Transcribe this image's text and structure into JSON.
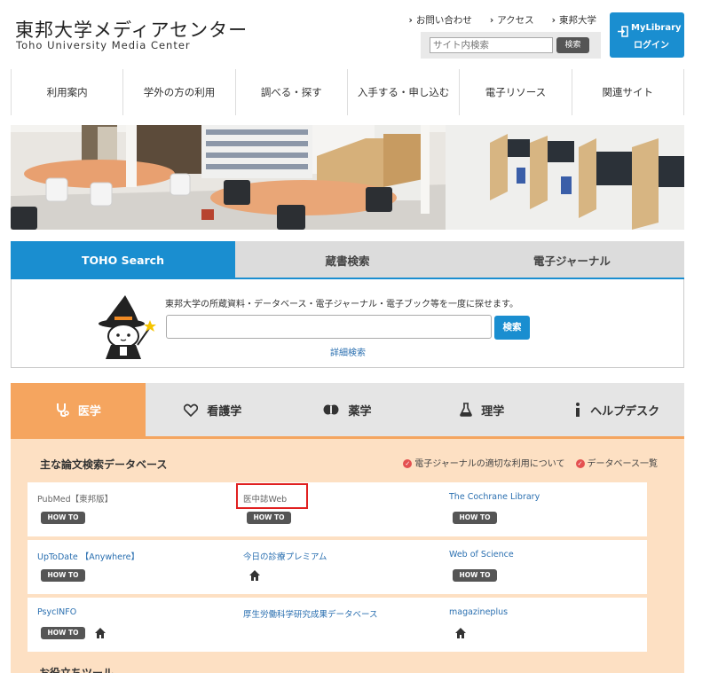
{
  "header": {
    "logo_jp": "東邦大学メディアセンター",
    "logo_en": "Toho University Media Center",
    "top_links": [
      "お問い合わせ",
      "アクセス",
      "東邦大学"
    ],
    "site_search_placeholder": "サイト内検索",
    "site_search_button": "検索",
    "mylibrary_line1": "MyLibrary",
    "mylibrary_line2": "ログイン"
  },
  "nav": [
    "利用案内",
    "学外の方の利用",
    "調べる・探す",
    "入手する・申し込む",
    "電子リソース",
    "関連サイト"
  ],
  "search": {
    "tabs": [
      "TOHO Search",
      "蔵書検索",
      "電子ジャーナル"
    ],
    "description": "東邦大学の所蔵資料・データベース・電子ジャーナル・電子ブック等を一度に探せます。",
    "button": "検索",
    "advanced": "詳細検索"
  },
  "subjects": [
    {
      "label": "医学",
      "icon": "stethoscope-icon"
    },
    {
      "label": "看護学",
      "icon": "heart-icon"
    },
    {
      "label": "薬学",
      "icon": "pill-icon"
    },
    {
      "label": "理学",
      "icon": "flask-icon"
    },
    {
      "label": "ヘルプデスク",
      "icon": "info-icon"
    }
  ],
  "panel": {
    "title": "主な論文検索データベース",
    "links": [
      "電子ジャーナルの適切な利用について",
      "データベース一覧"
    ],
    "howto_label": "HOW TO",
    "rows": [
      [
        {
          "name": "PubMed【東邦版】"
        },
        {
          "name": "医中誌Web"
        },
        {
          "name": "The Cochrane Library"
        }
      ],
      [
        {
          "name": "UpToDate 【Anywhere】"
        },
        {
          "name": "今日の診療プレミアム"
        },
        {
          "name": "Web of Science"
        }
      ],
      [
        {
          "name": "PsycINFO"
        },
        {
          "name": "厚生労働科学研究成果データベース"
        },
        {
          "name": "magazineplus"
        }
      ]
    ],
    "next_section_title": "お役立ちツール"
  },
  "colors": {
    "accent": "#1a8ed0",
    "subject_accent": "#f5a55f",
    "panel_bg": "#fde0c3"
  }
}
